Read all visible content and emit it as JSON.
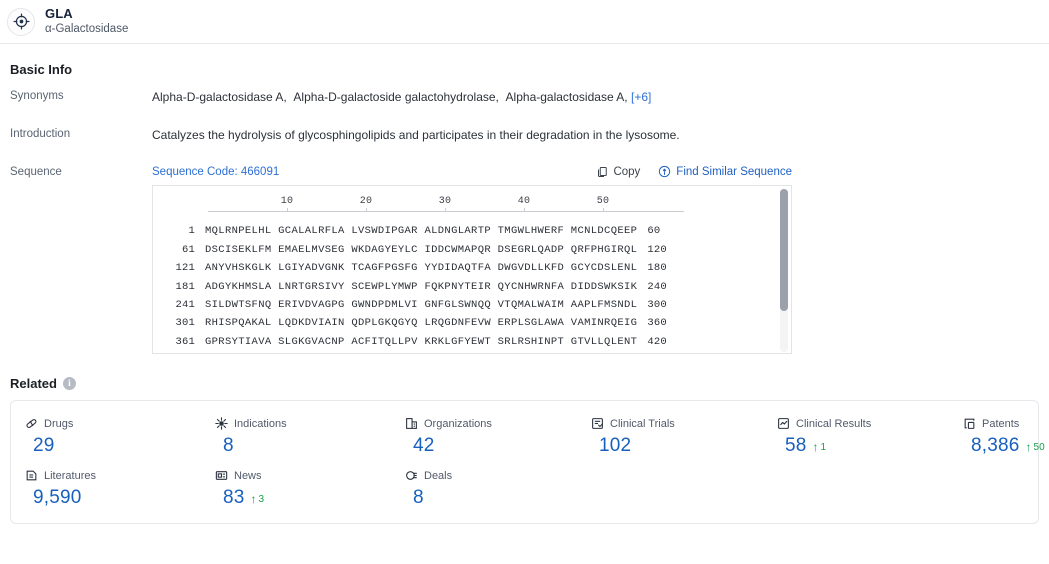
{
  "header": {
    "icon": "target-icon",
    "title": "GLA",
    "subtitle": "α-Galactosidase"
  },
  "basic_info": {
    "section_title": "Basic Info",
    "rows": [
      {
        "label": "Synonyms",
        "synonyms": [
          "Alpha-D-galactosidase A,",
          "Alpha-D-galactoside galactohydrolase,",
          "Alpha-galactosidase A,"
        ],
        "more_label": "[+6]"
      },
      {
        "label": "Introduction",
        "text": "Catalyzes the hydrolysis of glycosphingolipids and participates in their degradation in the lysosome."
      }
    ],
    "sequence": {
      "label": "Sequence",
      "code_label": "Sequence Code: 466091",
      "copy_label": "Copy",
      "copy_icon": "copy-icon",
      "similar_label": "Find Similar Sequence",
      "similar_icon": "find-similar-icon",
      "ruler": [
        "10",
        "20",
        "30",
        "40",
        "50"
      ],
      "rows": [
        {
          "start": "1",
          "chunks": "MQLRNPELHL GCALALRFLA LVSWDIPGAR ALDNGLARTP TMGWLHWERF MCNLDCQEEP",
          "end": "60"
        },
        {
          "start": "61",
          "chunks": "DSCISEKLFM EMAELMVSEG WKDAGYEYLC IDDCWMAPQR DSEGRLQADP QRFPHGIRQL",
          "end": "120"
        },
        {
          "start": "121",
          "chunks": "ANYVHSKGLK LGIYADVGNK TCAGFPGSFG YYDIDAQTFA DWGVDLLKFD GCYCDSLENL",
          "end": "180"
        },
        {
          "start": "181",
          "chunks": "ADGYKHMSLA LNRTGRSIVY SCEWPLYMWP FQKPNYTEIR QYCNHWRNFA DIDDSWKSIK",
          "end": "240"
        },
        {
          "start": "241",
          "chunks": "SILDWTSFNQ ERIVDVAGPG GWNDPDMLVI GNFGLSWNQQ VTQMALWAIM AAPLFMSNDL",
          "end": "300"
        },
        {
          "start": "301",
          "chunks": "RHISPQAKAL LQDKDVIAIN QDPLGKQGYQ LRQGDNFEVW ERPLSGLAWA VAMINRQEIG",
          "end": "360"
        },
        {
          "start": "361",
          "chunks": "GPRSYTIAVA SLGKGVACNP ACFITQLLPV KRKLGFYEWT SRLRSHINPT GTVLLQLENT",
          "end": "420"
        }
      ]
    }
  },
  "related": {
    "title": "Related",
    "info_icon": "info-icon",
    "rows": [
      [
        {
          "name": "Drugs",
          "icon": "pill-icon",
          "value": "29",
          "delta": null
        },
        {
          "name": "Indications",
          "icon": "virus-icon",
          "value": "8",
          "delta": null
        },
        {
          "name": "Organizations",
          "icon": "building-icon",
          "value": "42",
          "delta": null
        },
        {
          "name": "Clinical Trials",
          "icon": "clinical-trial-icon",
          "value": "102",
          "delta": null
        },
        {
          "name": "Clinical Results",
          "icon": "clinical-result-icon",
          "value": "58",
          "delta": "1"
        },
        {
          "name": "Patents",
          "icon": "patent-icon",
          "value": "8,386",
          "delta": "50"
        }
      ],
      [
        {
          "name": "Literatures",
          "icon": "literature-icon",
          "value": "9,590",
          "delta": null
        },
        {
          "name": "News",
          "icon": "news-icon",
          "value": "83",
          "delta": "3"
        },
        {
          "name": "Deals",
          "icon": "deal-icon",
          "value": "8",
          "delta": null
        }
      ]
    ],
    "delta_arrow": "↑"
  },
  "colors": {
    "link_blue": "#2d6fd4",
    "value_blue": "#1760bd",
    "delta_green": "#18a04a",
    "title_navy": "#16233b",
    "border_gray": "#e6e8ec"
  }
}
